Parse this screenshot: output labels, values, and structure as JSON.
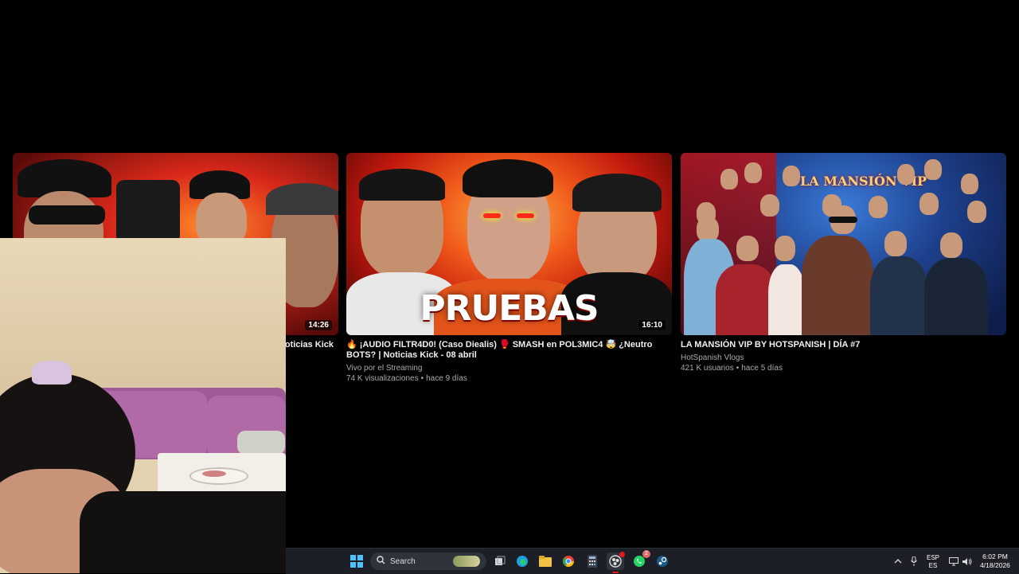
{
  "videos": [
    {
      "title": "Noticias Kick",
      "duration": "14:26",
      "channel": "",
      "views": "",
      "age": ""
    },
    {
      "title": "🔥 ¡AUDIO FILTR4D0! (Caso Diealis) 🥊 SMASH en POL3MIC4 🤯 ¿Neutro BOTS? | Noticias Kick - 08 abril",
      "duration": "16:10",
      "thumb_text": "PRUEBAS",
      "channel": "Vivo por el Streaming",
      "views": "74 K visualizaciones",
      "age": "hace 9 días"
    },
    {
      "title": "LA MANSIÓN VIP BY HOTSPANISH | DÍA #7",
      "duration": "",
      "thumb_text": "LA MANSIÓN VIP",
      "channel": "HotSpanish Vlogs",
      "views": "421 K usuarios",
      "age": "hace 5 días"
    }
  ],
  "taskbar": {
    "search_placeholder": "Search",
    "lang_top": "ESP",
    "lang_bottom": "ES",
    "time": "6:02 PM",
    "date": "4/18/2026",
    "whatsapp_badge": "2",
    "icons": [
      "windows-start-icon",
      "search-icon",
      "task-view-icon",
      "edge-icon",
      "file-explorer-icon",
      "chrome-icon",
      "calculator-icon",
      "obs-icon",
      "whatsapp-icon",
      "steam-icon"
    ]
  },
  "colors": {
    "background": "#000000",
    "taskbar": "#1c1f26",
    "meta_text": "#aaaaaa",
    "accent_red": "#e01a1a"
  }
}
